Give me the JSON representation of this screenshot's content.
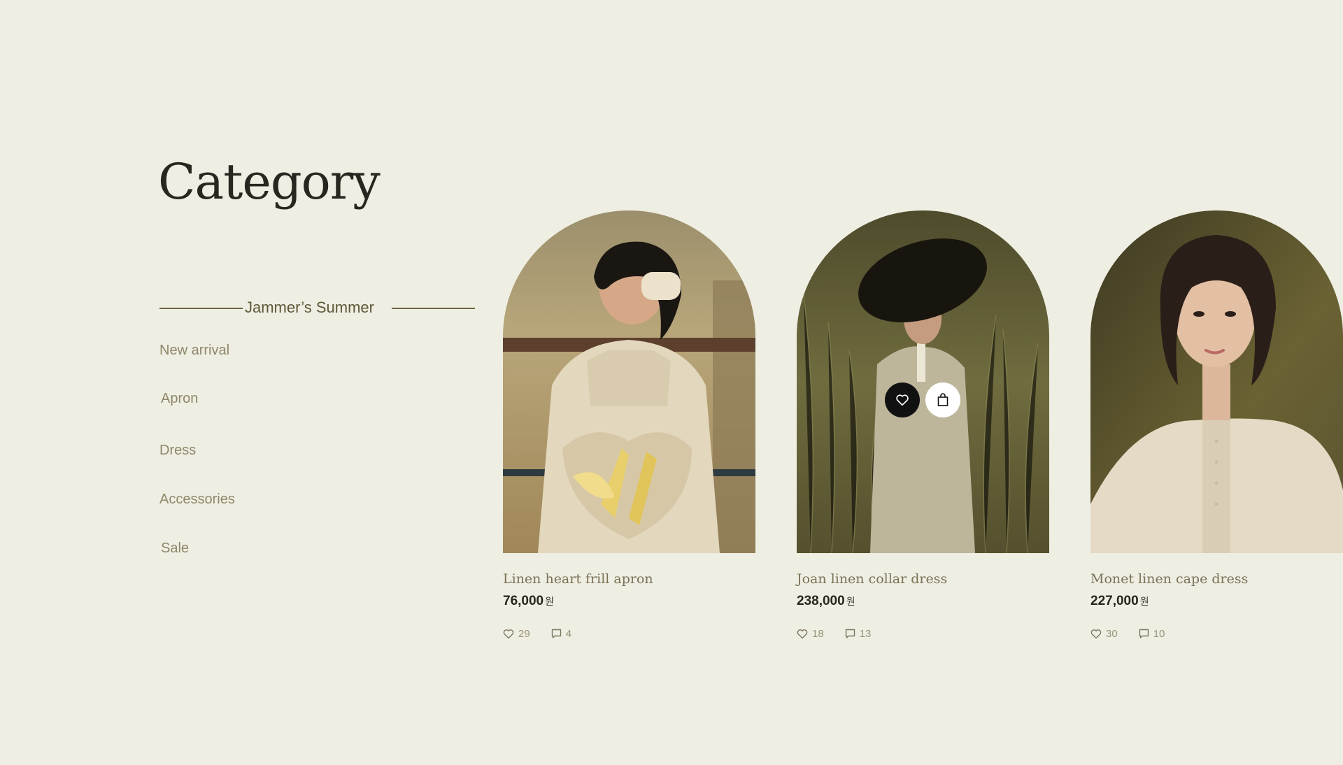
{
  "page": {
    "title": "Category"
  },
  "sidebar": {
    "collection_title": "Jammer’s Summer",
    "items": [
      {
        "label": "New arrival"
      },
      {
        "label": "Apron"
      },
      {
        "label": "Dress"
      },
      {
        "label": "Accessories"
      },
      {
        "label": "Sale"
      }
    ]
  },
  "products": [
    {
      "name": "Linen heart frill apron",
      "price": "76,000",
      "currency": "원",
      "likes": "29",
      "comments": "4",
      "image_icon": "apron-photo-icon"
    },
    {
      "name": "Joan linen collar dress",
      "price": "238,000",
      "currency": "원",
      "likes": "18",
      "comments": "13",
      "image_icon": "dress-photo-icon"
    },
    {
      "name": "Monet linen cape dress",
      "price": "227,000",
      "currency": "원",
      "likes": "30",
      "comments": "10",
      "image_icon": "cape-dress-photo-icon"
    }
  ],
  "icons": {
    "like": "heart-icon",
    "comment": "comment-icon",
    "cart": "shopping-bag-icon"
  },
  "colors": {
    "background": "#efeee3",
    "title": "#27261f",
    "muted": "#8e8769",
    "accent": "#6b6540"
  }
}
